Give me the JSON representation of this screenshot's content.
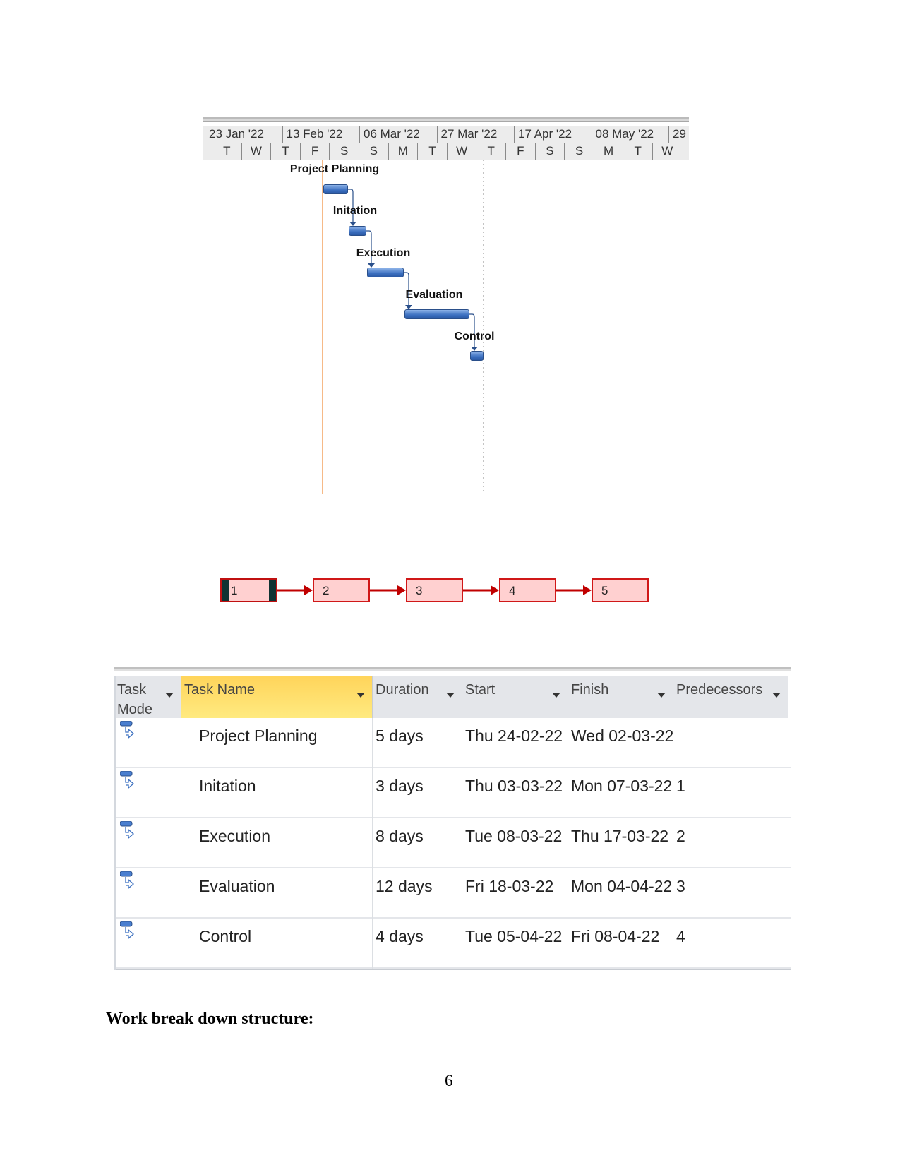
{
  "gantt": {
    "major_ticks": [
      "23 Jan '22",
      "13 Feb '22",
      "06 Mar '22",
      "27 Mar '22",
      "17 Apr '22",
      "08 May '22",
      "29"
    ],
    "minor_ticks": [
      "T",
      "W",
      "T",
      "F",
      "S",
      "S",
      "M",
      "T",
      "W",
      "T",
      "F",
      "S",
      "S",
      "M",
      "T",
      "W"
    ],
    "tasks": [
      {
        "label": "Project Planning"
      },
      {
        "label": "Initation"
      },
      {
        "label": "Execution"
      },
      {
        "label": "Evaluation"
      },
      {
        "label": "Control"
      }
    ],
    "colors": {
      "bar": "#3b6fc0",
      "today_line": "#f4a460",
      "status_line": "#888888"
    }
  },
  "network": {
    "nodes": [
      "1",
      "2",
      "3",
      "4",
      "5"
    ],
    "selected": "1",
    "colors": {
      "box_fill": "#ffd0d0",
      "border": "#d01818",
      "arrow": "#c00000"
    }
  },
  "table": {
    "headers": [
      {
        "label": "Task Mode"
      },
      {
        "label": "Task Name"
      },
      {
        "label": "Duration"
      },
      {
        "label": "Start"
      },
      {
        "label": "Finish"
      },
      {
        "label": "Predecessors"
      }
    ],
    "rows": [
      {
        "mode": "auto-scheduled-icon",
        "name": "Project Planning",
        "duration": "5 days",
        "start": "Thu 24-02-22",
        "finish": "Wed 02-03-22",
        "pred": ""
      },
      {
        "mode": "auto-scheduled-icon",
        "name": "Initation",
        "duration": "3 days",
        "start": "Thu 03-03-22",
        "finish": "Mon 07-03-22",
        "pred": "1"
      },
      {
        "mode": "auto-scheduled-icon",
        "name": "Execution",
        "duration": "8 days",
        "start": "Tue 08-03-22",
        "finish": "Thu 17-03-22",
        "pred": "2"
      },
      {
        "mode": "auto-scheduled-icon",
        "name": "Evaluation",
        "duration": "12 days",
        "start": "Fri 18-03-22",
        "finish": "Mon 04-04-22",
        "pred": "3"
      },
      {
        "mode": "auto-scheduled-icon",
        "name": "Control",
        "duration": "4 days",
        "start": "Tue 05-04-22",
        "finish": "Fri 08-04-22",
        "pred": "4"
      }
    ]
  },
  "heading": "Work break down structure:",
  "page_number": "6"
}
